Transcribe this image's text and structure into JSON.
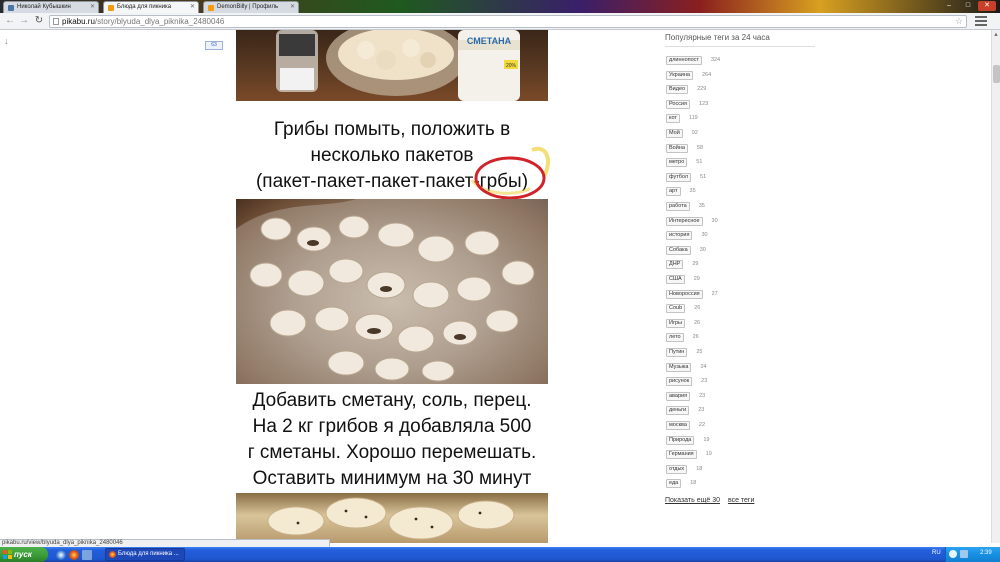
{
  "browser": {
    "tabs": [
      {
        "title": "Николай Кубышкин",
        "favicon_color": "#4a76a8",
        "active": false
      },
      {
        "title": "Блюда для пикника",
        "favicon_color": "#f39c12",
        "active": true
      },
      {
        "title": "DemonBilly | Профиль",
        "favicon_color": "#f39c12",
        "active": false
      }
    ],
    "window_controls": {
      "minimize": "–",
      "maximize": "□",
      "close": "✕"
    },
    "nav": {
      "back_icon": "←",
      "forward_icon": "→",
      "reload_icon": "↻"
    },
    "url": {
      "host": "pikabu.ru",
      "path": "/story/blyuda_dlya_piknika_2480046"
    },
    "star_icon": "☆"
  },
  "page": {
    "scroll_arrow": "↓",
    "share_widget": "63",
    "steps": [
      {
        "lines": [
          "Грибы помыть, положить в",
          "несколько пакетов",
          "(пакет-пакет-пакет-пакет-грбы)"
        ],
        "highlight": "грбы"
      },
      {
        "lines": [
          "Добавить сметану, соль, перец.",
          "На 2 кг грибов я добавляла 500",
          "г сметаны. Хорошо перемешать.",
          "Оставить минимум на 30 минут"
        ]
      }
    ],
    "photos": {
      "top_jar_label": "СМЕТАНА",
      "top_jar_fat": "20%"
    },
    "sidebar": {
      "title": "Популярные теги за 24 часа",
      "tags": [
        {
          "name": "длиннопост",
          "count": "324"
        },
        {
          "name": "Украина",
          "count": "264"
        },
        {
          "name": "Видео",
          "count": "229"
        },
        {
          "name": "Россия",
          "count": "123"
        },
        {
          "name": "кот",
          "count": "119"
        },
        {
          "name": "Мой",
          "count": "92"
        },
        {
          "name": "Война",
          "count": "58"
        },
        {
          "name": "метро",
          "count": "51"
        },
        {
          "name": "футбол",
          "count": "51"
        },
        {
          "name": "арт",
          "count": "35"
        },
        {
          "name": "работа",
          "count": "35"
        },
        {
          "name": "Интересное",
          "count": "30"
        },
        {
          "name": "история",
          "count": "30"
        },
        {
          "name": "Собака",
          "count": "30"
        },
        {
          "name": "ДНР",
          "count": "29"
        },
        {
          "name": "США",
          "count": "29"
        },
        {
          "name": "Новороссия",
          "count": "27"
        },
        {
          "name": "Coub",
          "count": "26"
        },
        {
          "name": "Игры",
          "count": "26"
        },
        {
          "name": "лето",
          "count": "26"
        },
        {
          "name": "Путин",
          "count": "25"
        },
        {
          "name": "Музыка",
          "count": "24"
        },
        {
          "name": "рисунок",
          "count": "23"
        },
        {
          "name": "авария",
          "count": "23"
        },
        {
          "name": "деньги",
          "count": "23"
        },
        {
          "name": "москва",
          "count": "22"
        },
        {
          "name": "Природа",
          "count": "19"
        },
        {
          "name": "Германия",
          "count": "19"
        },
        {
          "name": "отдых",
          "count": "18"
        },
        {
          "name": "еда",
          "count": "18"
        }
      ],
      "show_more": "Показать ещё 30",
      "all_tags": "все теги"
    }
  },
  "status_url": "pikabu.ru/view/blyuda_dlya_piknika_2480046",
  "taskbar": {
    "start_label": "пуск",
    "task_item": "Блюда для пикника ...",
    "lang": "RU",
    "clock": "2:39"
  }
}
